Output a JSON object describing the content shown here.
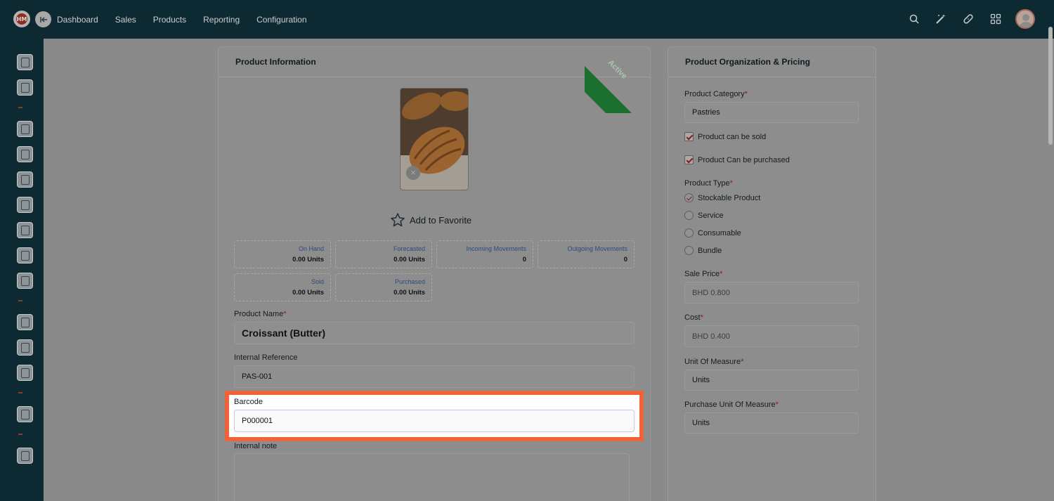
{
  "app": {
    "logo_text": "HM",
    "colors": {
      "nav_bg": "#0d2a33",
      "accent": "#f0633a",
      "ribbon": "#1b6f2f",
      "required": "#8b1a1a"
    }
  },
  "nav": {
    "items": [
      "Dashboard",
      "Sales",
      "Products",
      "Reporting",
      "Configuration"
    ],
    "right_icons": [
      "search-icon",
      "magic-wand-icon",
      "bandage-icon",
      "apps-grid-icon",
      "user-avatar"
    ]
  },
  "sidebar": {
    "icons": [
      "pos-icon",
      "orders-icon",
      "customers-icon",
      "reports-chart-icon",
      "invoice-icon",
      "documents-icon",
      "package-icon",
      "tickets-icon",
      "search-user-icon",
      "support-icon",
      "folder-icon",
      "register-icon",
      "settings-icon",
      "logout-icon"
    ]
  },
  "product_info": {
    "title": "Product Information",
    "status_ribbon": "Active",
    "image_close": "×",
    "favorite_label": "Add to Favorite",
    "stats": [
      {
        "label": "On Hand",
        "value": "0.00 Units",
        "icon": "info-icon"
      },
      {
        "label": "Forecasted",
        "value": "0.00 Units",
        "icon": "info-icon"
      },
      {
        "label": "Incoming Movements",
        "value": "0",
        "icon": "doc-icon"
      },
      {
        "label": "Outgoing Movements",
        "value": "0",
        "icon": "doc-icon"
      },
      {
        "label": "Sold",
        "value": "0.00 Units",
        "icon": "dollar-icon"
      },
      {
        "label": "Purchased",
        "value": "0.00 Units",
        "icon": "cart-icon"
      }
    ],
    "product_name_label": "Product Name",
    "product_name_value": "Croissant (Butter)",
    "internal_reference_label": "Internal Reference",
    "internal_reference_value": "PAS-001",
    "barcode_label": "Barcode",
    "barcode_value": "P000001",
    "internal_note_label": "Internal note",
    "required_mark": "*"
  },
  "org_pricing": {
    "title": "Product Organization & Pricing",
    "category_label": "Product Category",
    "category_value": "Pastries",
    "can_be_sold_label": "Product can be sold",
    "can_be_sold": true,
    "can_be_purchased_label": "Product Can be purchased",
    "can_be_purchased": true,
    "product_type_label": "Product Type",
    "product_types": [
      "Stockable Product",
      "Service",
      "Consumable",
      "Bundle"
    ],
    "selected_product_type": "Stockable Product",
    "sale_price_label": "Sale Price",
    "sale_price_value": "BHD 0.800",
    "cost_label": "Cost",
    "cost_value": "BHD 0.400",
    "uom_label": "Unit Of Measure",
    "uom_value": "Units",
    "purchase_uom_label": "Purchase Unit Of Measure",
    "purchase_uom_value": "Units"
  }
}
